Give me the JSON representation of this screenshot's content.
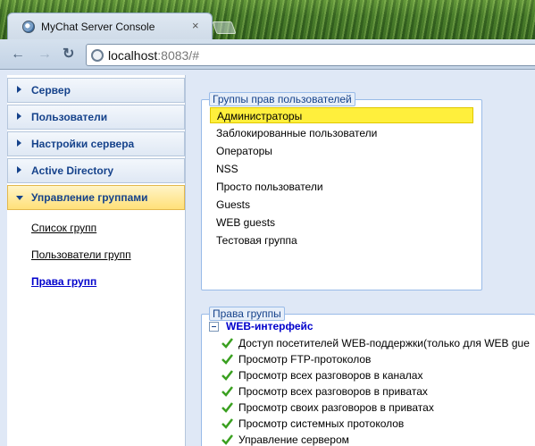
{
  "browser": {
    "tab_title": "MyChat Server Console",
    "tab_close": "×",
    "url_host": "localhost",
    "url_rest": ":8083/#"
  },
  "sidebar": {
    "items": [
      {
        "label": "Сервер"
      },
      {
        "label": "Пользователи"
      },
      {
        "label": "Настройки сервера"
      },
      {
        "label": "Active Directory"
      },
      {
        "label": "Управление группами"
      }
    ],
    "sub_links": [
      {
        "label": "Список групп"
      },
      {
        "label": "Пользователи групп"
      },
      {
        "label": "Права групп"
      }
    ]
  },
  "groups_panel": {
    "legend": "Группы прав пользователей",
    "groups": [
      "Администраторы",
      "Заблокированные пользователи",
      "Операторы",
      "NSS",
      "Просто пользователи",
      "Guests",
      "WEB guests",
      "Тестовая группа"
    ]
  },
  "rights_panel": {
    "legend": "Права группы",
    "tree_root": "WEB-интерфейс",
    "permissions": [
      "Доступ посетителей WEB-поддержки(только для WEB gue",
      "Просмотр FTP-протоколов",
      "Просмотр всех разговоров в каналах",
      "Просмотр всех разговоров в приватах",
      "Просмотр своих разговоров в приватах",
      "Просмотр системных протоколов",
      "Управление сервером"
    ]
  },
  "colors": {
    "accent": "#15428b",
    "selected_row": "#ffef3c",
    "active_nav": "#ffe079",
    "check": "#3aa020"
  }
}
